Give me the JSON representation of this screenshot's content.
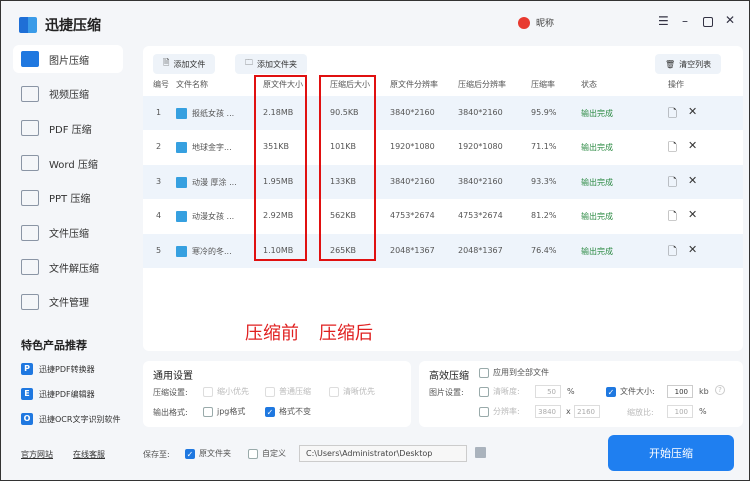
{
  "app": {
    "title": "迅捷压缩",
    "user": "昵称"
  },
  "sidebar": {
    "items": [
      {
        "label": "图片压缩"
      },
      {
        "label": "视频压缩"
      },
      {
        "label": "PDF 压缩"
      },
      {
        "label": "Word 压缩"
      },
      {
        "label": "PPT 压缩"
      },
      {
        "label": "文件压缩"
      },
      {
        "label": "文件解压缩"
      },
      {
        "label": "文件管理"
      }
    ],
    "featured_title": "特色产品推荐",
    "products": [
      {
        "label": "迅捷PDF转换器",
        "icon": "P"
      },
      {
        "label": "迅捷PDF编辑器",
        "icon": "E"
      },
      {
        "label": "迅捷OCR文字识别软件",
        "icon": "O"
      }
    ],
    "links": [
      "官方网站",
      "在线客服"
    ]
  },
  "toolbar": {
    "add_file": "添加文件",
    "add_folder": "添加文件夹",
    "clear_list": "清空列表"
  },
  "table": {
    "headers": [
      "编号",
      "文件名称",
      "原文件大小",
      "压缩后大小",
      "原文件分辨率",
      "压缩后分辨率",
      "压缩率",
      "状态",
      "操作"
    ],
    "rows": [
      [
        "1",
        "报纸女孩 ...",
        "2.18MB",
        "90.5KB",
        "3840*2160",
        "3840*2160",
        "95.9%",
        "输出完成"
      ],
      [
        "2",
        "地球金字...",
        "351KB",
        "101KB",
        "1920*1080",
        "1920*1080",
        "71.1%",
        "输出完成"
      ],
      [
        "3",
        "动漫 厚涂 ...",
        "1.95MB",
        "133KB",
        "3840*2160",
        "3840*2160",
        "93.3%",
        "输出完成"
      ],
      [
        "4",
        "动漫女孩 ...",
        "2.92MB",
        "562KB",
        "4753*2674",
        "4753*2674",
        "81.2%",
        "输出完成"
      ],
      [
        "5",
        "寒冷的冬...",
        "1.10MB",
        "265KB",
        "2048*1367",
        "2048*1367",
        "76.4%",
        "输出完成"
      ]
    ]
  },
  "annotations": {
    "before": "压缩前",
    "after": "压缩后"
  },
  "general": {
    "title": "通用设置",
    "compress_label": "压缩设置:",
    "opt1": "缩小优先",
    "opt2": "普通压缩",
    "opt3": "清晰优先",
    "format_label": "输出格式:",
    "jpg": "jpg格式",
    "keep": "格式不变"
  },
  "efficient": {
    "title": "高效压缩",
    "apply_all": "应用到全部文件",
    "image_label": "图片设置:",
    "clarity": "清晰度:",
    "clarity_val": "50",
    "pct": "%",
    "filesize": "文件大小:",
    "filesize_val": "100",
    "kb": "kb",
    "resolution": "分辨率:",
    "res_w": "3840",
    "x": "x",
    "res_h": "2160",
    "scale": "缩放比:",
    "scale_val": "100",
    "pct2": "%"
  },
  "save": {
    "label": "保存至:",
    "original": "原文件夹",
    "custom": "自定义",
    "path": "C:\\Users\\Administrator\\Desktop"
  },
  "start_button": "开始压缩"
}
